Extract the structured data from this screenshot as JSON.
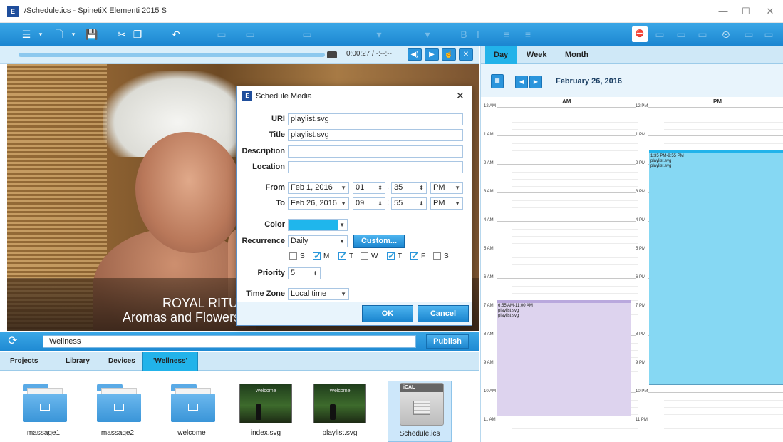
{
  "window": {
    "title": "/Schedule.ics - SpinetiX Elementi 2015 S",
    "app_icon": "E",
    "controls": [
      "—",
      "☐",
      "✕"
    ]
  },
  "media": {
    "time": "0:00:27 / -:--:--"
  },
  "preview": {
    "line1": "ROYAL RITU",
    "line2": "Aromas and Flowers"
  },
  "search": {
    "value": "Wellness",
    "publish": "Publish"
  },
  "tabs": [
    "Projects",
    "Library",
    "Devices",
    "'Wellness'"
  ],
  "files": [
    {
      "name": "massage1"
    },
    {
      "name": "massage2"
    },
    {
      "name": "welcome"
    },
    {
      "name": "index.svg",
      "thumb_text": "Welcome"
    },
    {
      "name": "playlist.svg",
      "thumb_text": "Welcome"
    },
    {
      "name": "Schedule.ics",
      "header": "iCAL"
    }
  ],
  "calendar": {
    "tabs": [
      "Day",
      "Week",
      "Month"
    ],
    "date": "February 26, 2016",
    "am": "AM",
    "pm": "PM",
    "am_hours": [
      "12 AM",
      "1 AM",
      "2 AM",
      "3 AM",
      "4 AM",
      "5 AM",
      "6 AM",
      "7 AM",
      "8 AM",
      "9 AM",
      "10 AM",
      "11 AM"
    ],
    "pm_hours": [
      "12 PM",
      "1 PM",
      "2 PM",
      "3 PM",
      "4 PM",
      "5 PM",
      "6 PM",
      "7 PM",
      "8 PM",
      "9 PM",
      "10 PM",
      "11 PM"
    ],
    "events": [
      {
        "time": "6:55 AM-11:00 AM",
        "line1": "playlist.svg",
        "line2": "playlist.svg",
        "color": "#ddd3ee"
      },
      {
        "time": "1:35 PM-9:55 PM",
        "line1": "playlist.svg",
        "line2": "playlist.svg",
        "color": "#86d8f3"
      }
    ]
  },
  "dialog": {
    "title": "Schedule Media",
    "uri_label": "URI",
    "uri": "playlist.svg",
    "title_label": "Title",
    "title_value": "playlist.svg",
    "description_label": "Description",
    "description": "",
    "location_label": "Location",
    "location": "",
    "from_label": "From",
    "from_date": "Feb 1, 2016",
    "from_hour": "01",
    "from_min": "35",
    "from_ampm": "PM",
    "to_label": "To",
    "to_date": "Feb 26, 2016",
    "to_hour": "09",
    "to_min": "55",
    "to_ampm": "PM",
    "color_label": "Color",
    "color": "#1fb6ec",
    "recurrence_label": "Recurrence",
    "recurrence": "Daily",
    "custom": "Custom...",
    "days": [
      {
        "label": "S",
        "checked": false
      },
      {
        "label": "M",
        "checked": true
      },
      {
        "label": "T",
        "checked": true
      },
      {
        "label": "W",
        "checked": false
      },
      {
        "label": "T",
        "checked": true
      },
      {
        "label": "F",
        "checked": true
      },
      {
        "label": "S",
        "checked": false
      }
    ],
    "priority_label": "Priority",
    "priority": "5",
    "timezone_label": "Time Zone",
    "timezone": "Local time",
    "ok": "OK",
    "cancel": "Cancel"
  }
}
